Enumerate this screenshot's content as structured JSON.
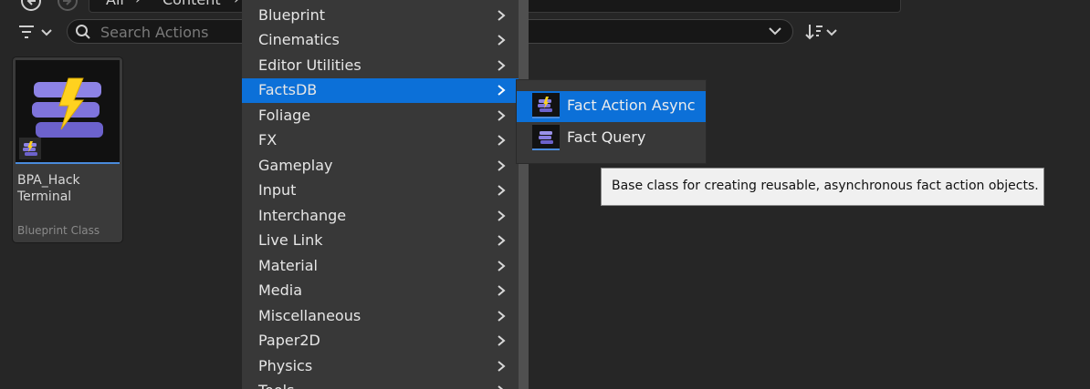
{
  "breadcrumb": {
    "items": [
      "All",
      "Content"
    ]
  },
  "search": {
    "placeholder": "Search Actions",
    "value": ""
  },
  "asset": {
    "name": "BPA_Hack Terminal",
    "type": "Blueprint Class",
    "icon": "lightning-fact-icon"
  },
  "menu": {
    "items": [
      {
        "label": "Blueprint"
      },
      {
        "label": "Cinematics"
      },
      {
        "label": "Editor Utilities"
      },
      {
        "label": "FactsDB",
        "highlighted": true
      },
      {
        "label": "Foliage"
      },
      {
        "label": "FX"
      },
      {
        "label": "Gameplay"
      },
      {
        "label": "Input"
      },
      {
        "label": "Interchange"
      },
      {
        "label": "Live Link"
      },
      {
        "label": "Material"
      },
      {
        "label": "Media"
      },
      {
        "label": "Miscellaneous"
      },
      {
        "label": "Paper2D"
      },
      {
        "label": "Physics"
      },
      {
        "label": "Tools"
      }
    ]
  },
  "submenu": {
    "items": [
      {
        "label": "Fact Action Async",
        "highlighted": true
      },
      {
        "label": "Fact Query"
      }
    ]
  },
  "tooltip": {
    "text": "Base class for creating reusable, asynchronous fact action objects."
  },
  "colors": {
    "highlight": "#0c70d8",
    "menu_bg": "#383838",
    "background": "#262626",
    "accent_underline": "#4a8bdc"
  }
}
